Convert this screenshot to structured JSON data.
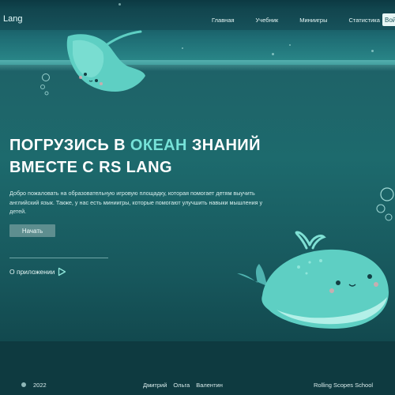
{
  "header": {
    "logo": "Lang",
    "nav": [
      "Главная",
      "Учебник",
      "Миниигры",
      "Статистика"
    ],
    "button_label": "Вой"
  },
  "hero": {
    "title_part1": "ПОГРУЗИСЬ В ",
    "title_accent": "ОКЕАН",
    "title_part2": " ЗНАНИЙ",
    "title_line2": "ВМЕСТЕ С RS LANG",
    "description": "Добро пожаловать на образовательную игровую площадку, которая помогает детям выучить английский язык. Также, у нас есть миниигры, которые помогают улучшить навыки мышления у детей.",
    "start_button": "Начать",
    "about_link": "О приложении"
  },
  "footer": {
    "year": "2022",
    "authors": [
      "Дмитрий",
      "Ольга",
      "Валентин"
    ],
    "school": "Rolling Scopes School"
  },
  "colors": {
    "accent": "#76e2d8",
    "background": "#1d6a6d",
    "footer_bg": "#0e3a40"
  },
  "icons": [
    "github-icon",
    "arrow-right-icon",
    "whale-illustration",
    "stingray-illustration"
  ]
}
